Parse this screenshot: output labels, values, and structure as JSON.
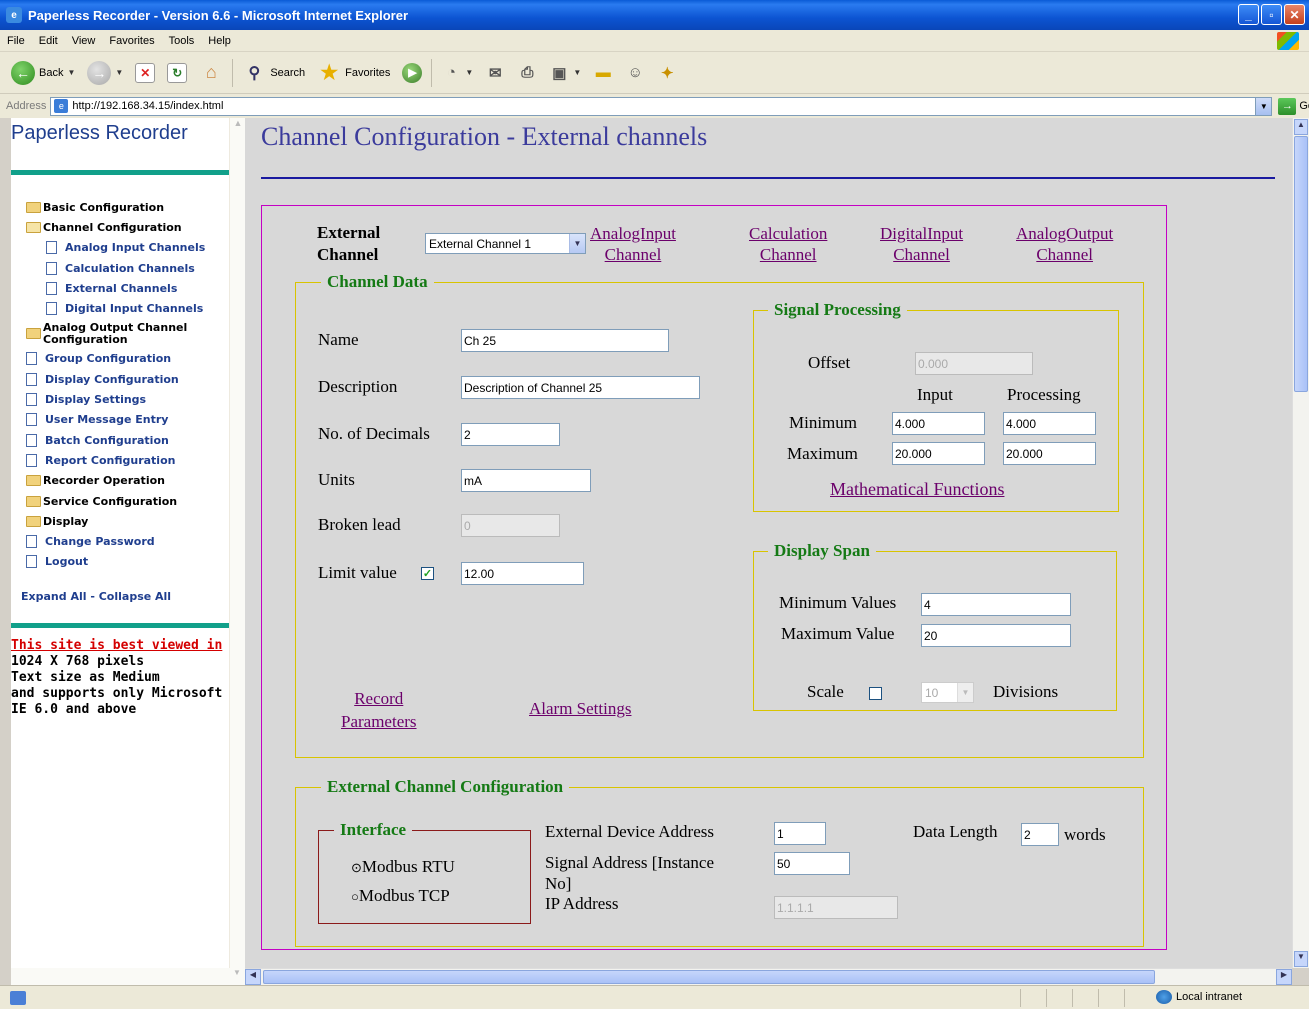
{
  "window": {
    "title": "Paperless Recorder - Version 6.6 - Microsoft Internet Explorer",
    "controls": [
      "minimize",
      "maximize",
      "close"
    ]
  },
  "menu": [
    "File",
    "Edit",
    "View",
    "Favorites",
    "Tools",
    "Help"
  ],
  "toolbar": {
    "back_label": "Back",
    "search_label": "Search",
    "favorites_label": "Favorites"
  },
  "address": {
    "label": "Address",
    "url": "http://192.168.34.15/index.html",
    "go_label": "Go"
  },
  "sidebar": {
    "title": "Paperless Recorder",
    "items": [
      {
        "label": "Basic Configuration",
        "type": "folder"
      },
      {
        "label": "Channel Configuration",
        "type": "folder-open"
      },
      {
        "label": "Analog Input Channels",
        "type": "page"
      },
      {
        "label": "Calculation Channels",
        "type": "page"
      },
      {
        "label": "External Channels",
        "type": "page"
      },
      {
        "label": "Digital Input Channels",
        "type": "page"
      },
      {
        "label": "Analog Output Channel Configuration",
        "type": "folder"
      },
      {
        "label": "Group Configuration",
        "type": "page"
      },
      {
        "label": "Display Configuration",
        "type": "page"
      },
      {
        "label": "Display Settings",
        "type": "page"
      },
      {
        "label": "User Message Entry",
        "type": "page"
      },
      {
        "label": "Batch Configuration",
        "type": "page"
      },
      {
        "label": "Report Configuration",
        "type": "page"
      },
      {
        "label": "Recorder Operation",
        "type": "folder"
      },
      {
        "label": "Service Configuration",
        "type": "folder"
      },
      {
        "label": "Display",
        "type": "folder"
      },
      {
        "label": "Change Password",
        "type": "page"
      },
      {
        "label": "Logout",
        "type": "page"
      }
    ],
    "expand_collapse": "Expand All - Collapse All",
    "notice_link": "This site is best viewed in",
    "notice_lines": [
      "1024 X 768 pixels",
      "Text size as Medium",
      "and supports only Microsoft",
      "IE 6.0 and above"
    ]
  },
  "page": {
    "title": "Channel Configuration - External channels",
    "channel_label_line1": "External",
    "channel_label_line2": "Channel",
    "channel_select": "External Channel 1",
    "nav_links": [
      {
        "line1": "AnalogInput",
        "line2": "Channel"
      },
      {
        "line1": "Calculation",
        "line2": "Channel"
      },
      {
        "line1": "DigitalInput",
        "line2": "Channel"
      },
      {
        "line1": "AnalogOutput",
        "line2": "Channel"
      }
    ],
    "channel_data": {
      "legend": "Channel Data",
      "name_label": "Name",
      "name_value": "Ch 25",
      "description_label": "Description",
      "description_value": "Description of Channel 25",
      "decimals_label": "No. of Decimals",
      "decimals_value": "2",
      "units_label": "Units",
      "units_value": "mA",
      "broken_lead_label": "Broken lead",
      "broken_lead_value": "0",
      "limit_label": "Limit value",
      "limit_checked": true,
      "limit_value": "12.00",
      "record_link_line1": "Record",
      "record_link_line2": "Parameters",
      "alarm_link": "Alarm Settings"
    },
    "signal_processing": {
      "legend": "Signal Processing",
      "offset_label": "Offset",
      "offset_value": "0.000",
      "input_header": "Input",
      "processing_header": "Processing",
      "minimum_label": "Minimum",
      "min_input": "4.000",
      "min_processing": "4.000",
      "maximum_label": "Maximum",
      "max_input": "20.000",
      "max_processing": "20.000",
      "math_link": "Mathematical Functions"
    },
    "display_span": {
      "legend": "Display Span",
      "min_label": "Minimum Values",
      "min_value": "4",
      "max_label": "Maximum Value",
      "max_value": "20",
      "scale_label": "Scale",
      "scale_checked": false,
      "divisions_value": "10",
      "divisions_label": "Divisions"
    },
    "external_config": {
      "legend": "External Channel Configuration",
      "interface_legend": "Interface",
      "rtu_label": "Modbus RTU",
      "tcp_label": "Modbus TCP",
      "selected_interface": "Modbus RTU",
      "device_address_label": "External Device Address",
      "device_address_value": "1",
      "signal_address_label_line1": "Signal Address [Instance",
      "signal_address_label_line2": "No]",
      "signal_address_value": "50",
      "ip_label": "IP Address",
      "ip_value": "1.1.1.1",
      "data_length_label": "Data Length",
      "data_length_value": "2",
      "words_label": "words"
    }
  },
  "status": {
    "zone": "Local intranet"
  },
  "colors": {
    "sidebar_link": "#1f3e8e",
    "page_title": "#3b3b9c",
    "legend_green": "#157a15",
    "link_purple": "#6b006b",
    "magenta_border": "#c400c4",
    "yellow_border": "#d8c400",
    "teal_rule": "#11a08a"
  }
}
